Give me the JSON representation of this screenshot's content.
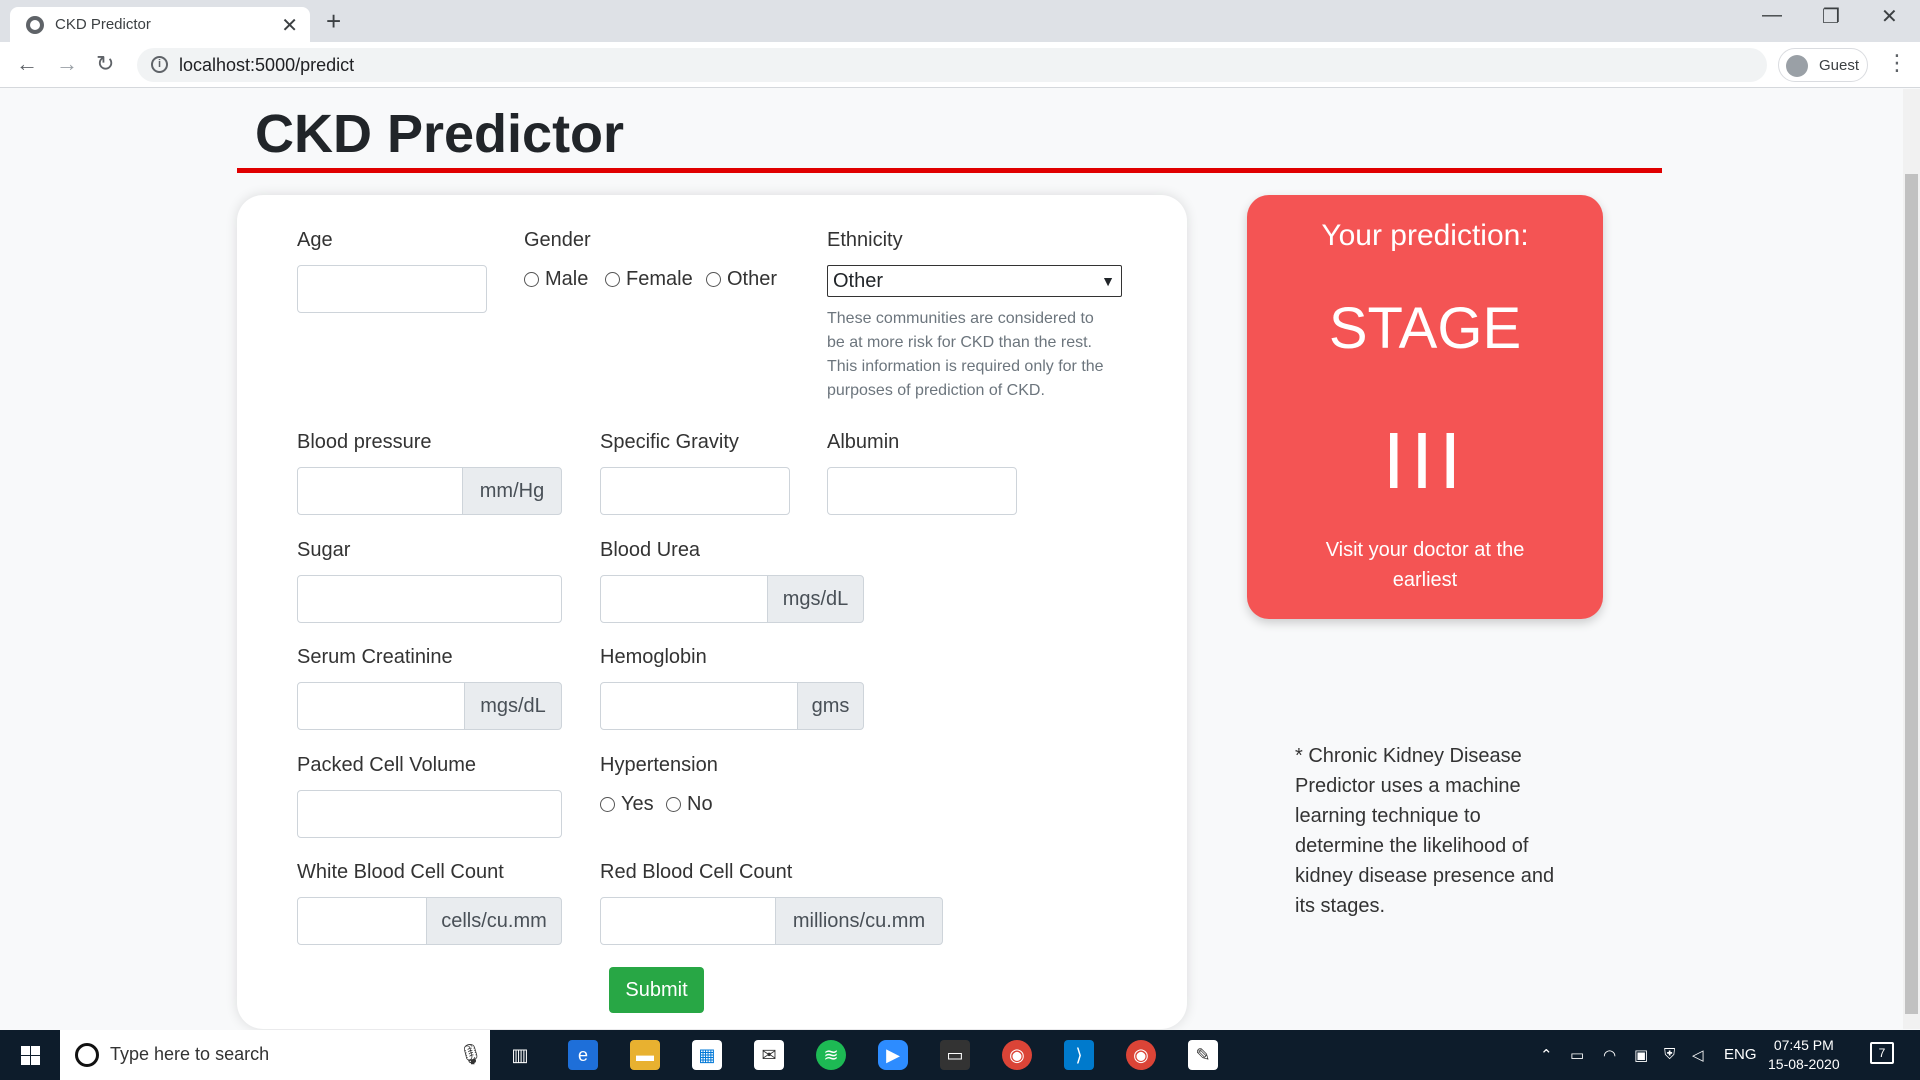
{
  "browser": {
    "tab_title": "CKD Predictor",
    "tab_close": "✕",
    "new_tab": "+",
    "url": "localhost:5000/predict",
    "profile": "Guest",
    "back": "←",
    "forward": "→",
    "reload": "↻",
    "minimize": "—",
    "maximize": "❐",
    "close": "✕",
    "menu": "⋮"
  },
  "page": {
    "title": "CKD Predictor"
  },
  "form": {
    "age_label": "Age",
    "gender_label": "Gender",
    "gender_options": [
      "Male",
      "Female",
      "Other"
    ],
    "ethnicity_label": "Ethnicity",
    "ethnicity_value": "Other",
    "ethnicity_help": "These communities are considered to be at more risk for CKD than the rest. This information is required only for the purposes of prediction of CKD.",
    "bp_label": "Blood pressure",
    "bp_unit": "mm/Hg",
    "sg_label": "Specific Gravity",
    "albumin_label": "Albumin",
    "sugar_label": "Sugar",
    "urea_label": "Blood Urea",
    "urea_unit": "mgs/dL",
    "creat_label": "Serum Creatinine",
    "creat_unit": "mgs/dL",
    "hemo_label": "Hemoglobin",
    "hemo_unit": "gms",
    "pcv_label": "Packed Cell Volume",
    "htn_label": "Hypertension",
    "htn_options": [
      "Yes",
      "No"
    ],
    "wbc_label": "White Blood Cell Count",
    "wbc_unit": "cells/cu.mm",
    "rbc_label": "Red Blood Cell Count",
    "rbc_unit": "millions/cu.mm",
    "submit_label": "Submit"
  },
  "prediction": {
    "heading": "Your prediction:",
    "stage_word": "STAGE",
    "stage_value": "III",
    "advice": "Visit your doctor at the earliest"
  },
  "note": "* Chronic Kidney Disease Predictor uses a machine learning technique to determine the likelihood of kidney disease presence and its stages.",
  "taskbar": {
    "search_placeholder": "Type here to search",
    "language": "ENG",
    "time": "07:45 PM",
    "date": "15-08-2020",
    "notification_count": "7"
  },
  "colors": {
    "accent_red": "#e00000",
    "prediction_bg": "#f45454",
    "submit_green": "#28a745"
  }
}
